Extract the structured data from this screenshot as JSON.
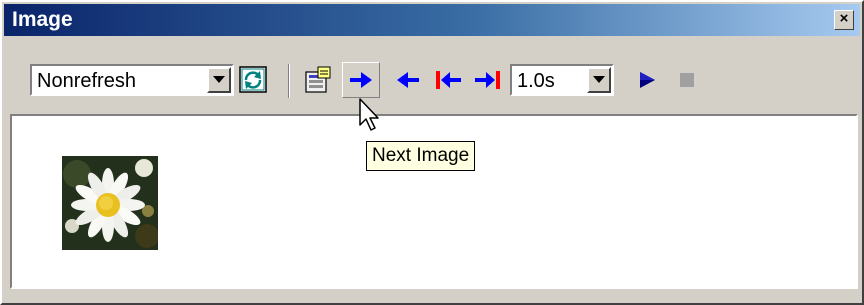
{
  "window": {
    "title": "Image",
    "close_glyph": "×"
  },
  "toolbar": {
    "refresh_mode": {
      "value": "Nonrefresh"
    },
    "refresh_button": {
      "icon": "refresh-icon"
    },
    "properties_button": {
      "icon": "properties-icon"
    },
    "next_button": {
      "icon": "next-arrow-icon",
      "tooltip": "Next Image"
    },
    "previous_button": {
      "icon": "previous-arrow-icon"
    },
    "first_button": {
      "icon": "first-image-icon"
    },
    "last_button": {
      "icon": "last-image-icon"
    },
    "interval": {
      "value": "1.0s"
    },
    "play_button": {
      "icon": "play-icon"
    },
    "stop_button": {
      "icon": "stop-icon"
    }
  },
  "content": {
    "thumbnail": {
      "subject": "daisy-flower-image"
    }
  },
  "colors": {
    "arrow_blue": "#0000ff",
    "bar_red": "#ff0000",
    "face": "#d4d0c8",
    "tooltip_bg": "#ffffe1"
  }
}
